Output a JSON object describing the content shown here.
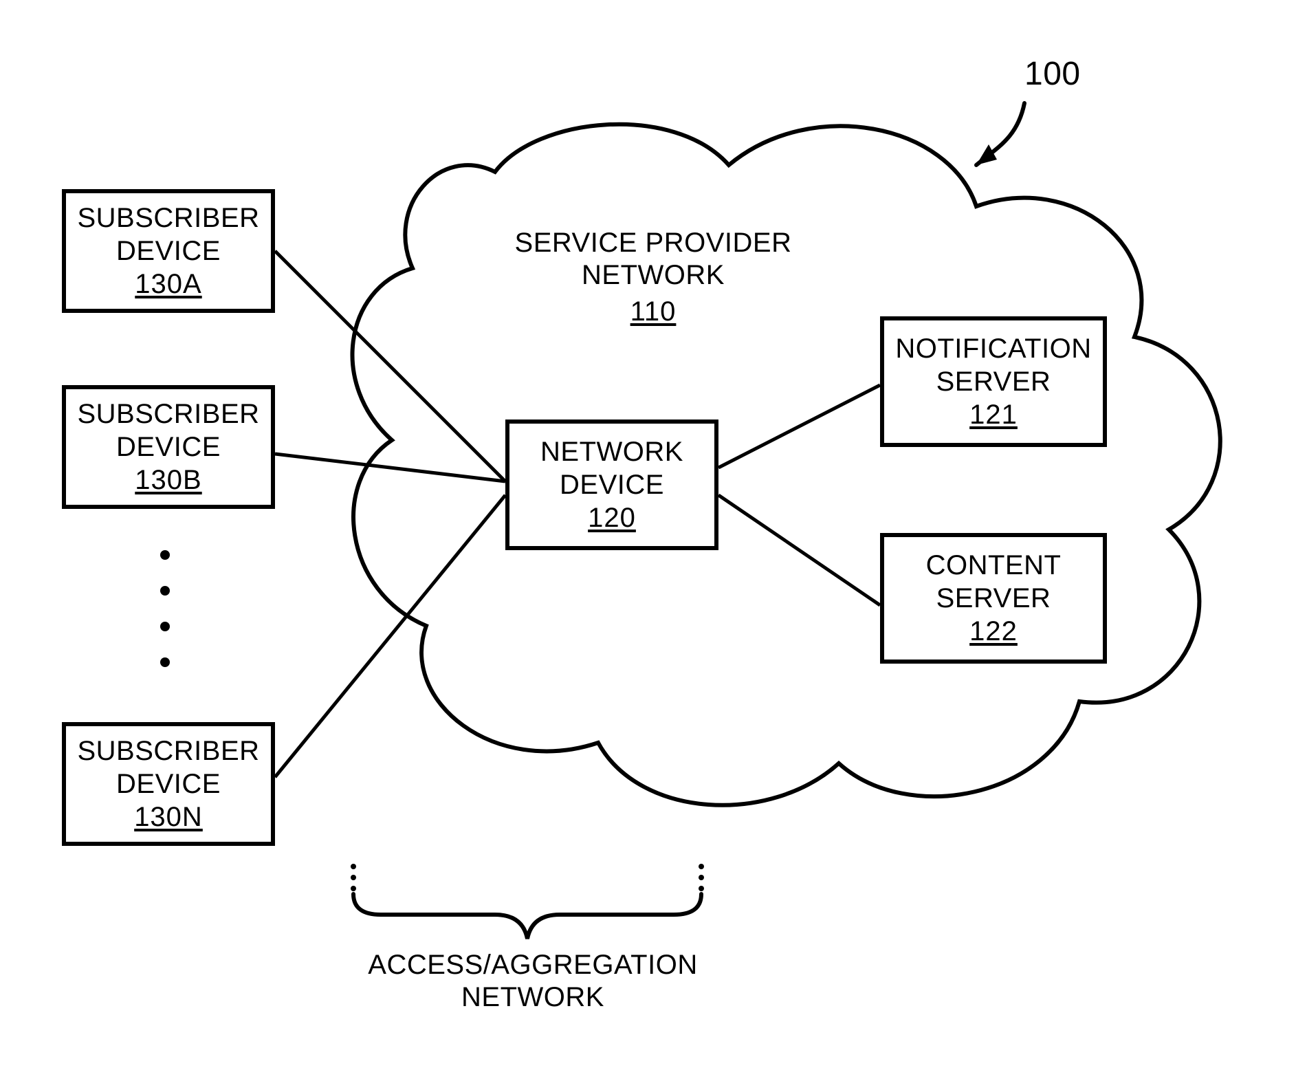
{
  "figure_ref": "100",
  "cloud": {
    "title_line1": "SERVICE PROVIDER",
    "title_line2": "NETWORK",
    "ref": "110"
  },
  "network_device": {
    "line1": "NETWORK",
    "line2": "DEVICE",
    "ref": "120"
  },
  "notification_server": {
    "line1": "NOTIFICATION",
    "line2": "SERVER",
    "ref": "121"
  },
  "content_server": {
    "line1": "CONTENT",
    "line2": "SERVER",
    "ref": "122"
  },
  "subscribers": {
    "a": {
      "line1": "SUBSCRIBER",
      "line2": "DEVICE",
      "ref": "130A"
    },
    "b": {
      "line1": "SUBSCRIBER",
      "line2": "DEVICE",
      "ref": "130B"
    },
    "n": {
      "line1": "SUBSCRIBER",
      "line2": "DEVICE",
      "ref": "130N"
    }
  },
  "access_aggregation": {
    "line1": "ACCESS/AGGREGATION",
    "line2": "NETWORK"
  }
}
